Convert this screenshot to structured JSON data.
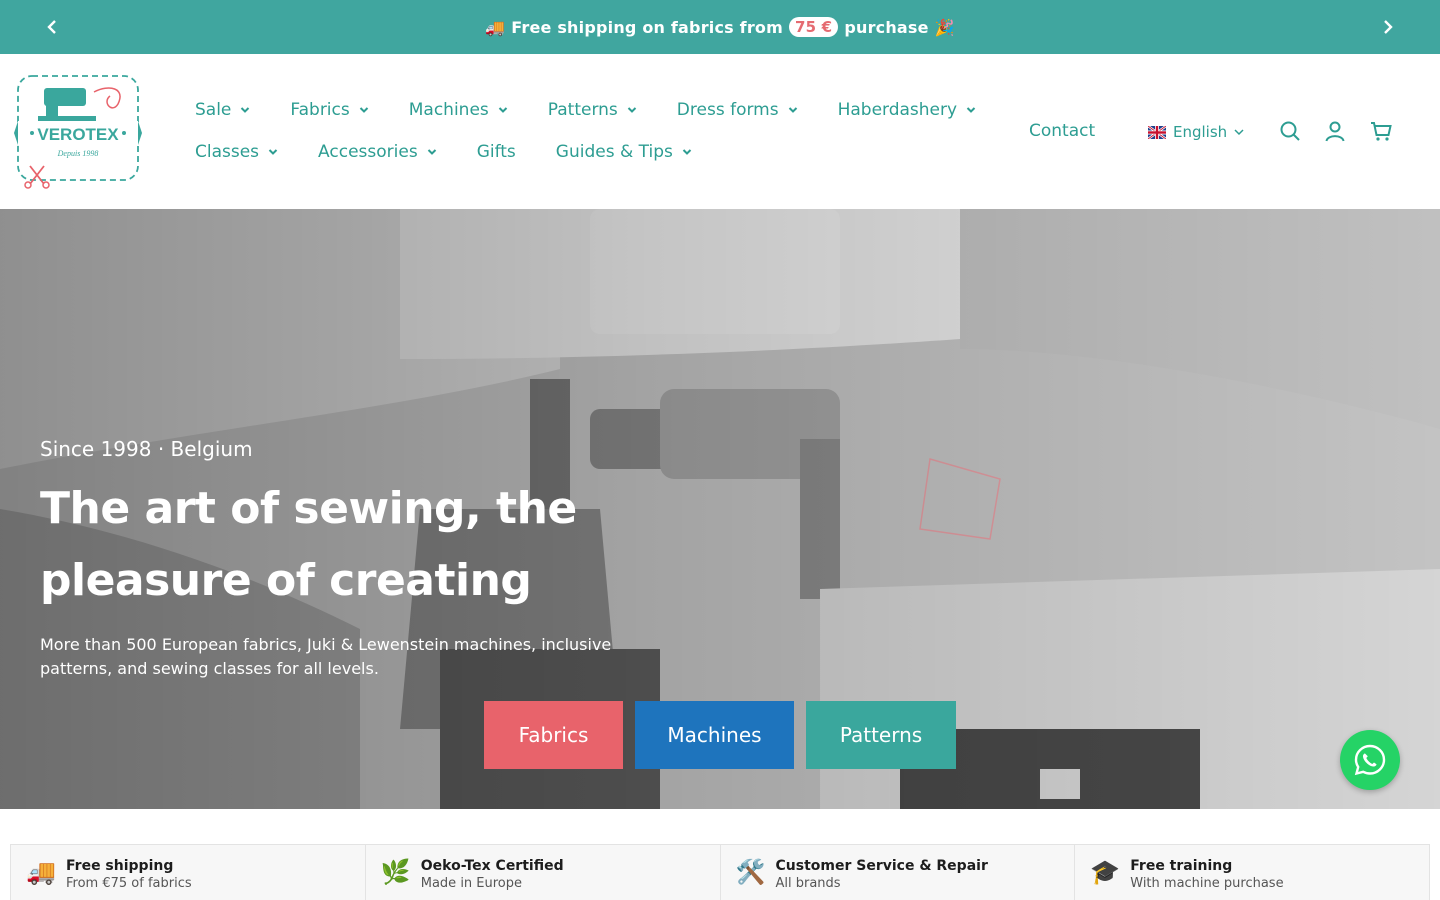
{
  "announcement": {
    "emoji_left": "🚚",
    "text_before": "Free shipping on fabrics from",
    "amount": "75 €",
    "text_after": "purchase",
    "emoji_right": "🎉",
    "prev_icon": "chevron-left-icon",
    "next_icon": "chevron-right-icon"
  },
  "logo": {
    "brand": "VEROTEX",
    "tagline": "Depuis 1998"
  },
  "nav": {
    "row1": [
      {
        "label": "Sale",
        "dropdown": true
      },
      {
        "label": "Fabrics",
        "dropdown": true
      },
      {
        "label": "Machines",
        "dropdown": true
      },
      {
        "label": "Patterns",
        "dropdown": true
      },
      {
        "label": "Dress forms",
        "dropdown": true
      },
      {
        "label": "Haberdashery",
        "dropdown": true
      }
    ],
    "row2": [
      {
        "label": "Classes",
        "dropdown": true
      },
      {
        "label": "Accessories",
        "dropdown": true
      },
      {
        "label": "Gifts",
        "dropdown": false
      },
      {
        "label": "Guides & Tips",
        "dropdown": true
      }
    ],
    "contact": "Contact",
    "language": "English"
  },
  "hero": {
    "eyebrow": "Since 1998 · Belgium",
    "title": "The art of sewing, the pleasure of creating",
    "subtitle": "More than 500 European fabrics, Juki & Lewenstein machines, inclusive patterns, and sewing classes for all levels.",
    "buttons": {
      "fabrics": "Fabrics",
      "machines": "Machines",
      "patterns": "Patterns"
    }
  },
  "features": [
    {
      "icon": "🚚",
      "title": "Free shipping",
      "subtitle": "From €75 of fabrics"
    },
    {
      "icon": "🌿",
      "title": "Oeko-Tex Certified",
      "subtitle": "Made in Europe"
    },
    {
      "icon": "🛠️",
      "title": "Customer Service & Repair",
      "subtitle": "All brands"
    },
    {
      "icon": "🎓",
      "title": "Free training",
      "subtitle": "With machine purchase"
    }
  ],
  "colors": {
    "teal": "#40a69f",
    "coral": "#e8636b",
    "blue": "#1e74bd",
    "whatsapp": "#25d366"
  }
}
